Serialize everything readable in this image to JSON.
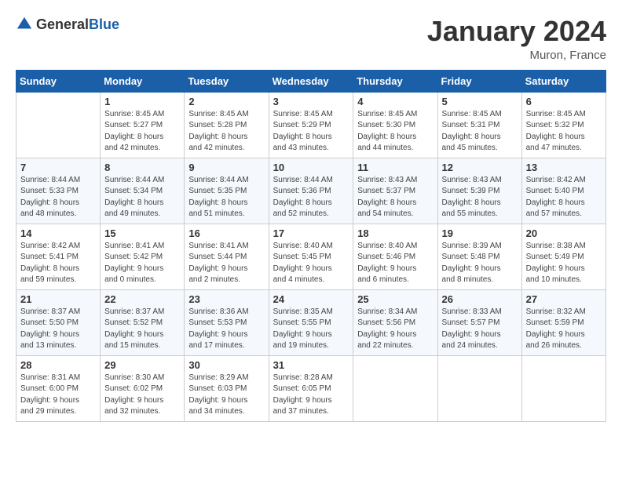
{
  "logo": {
    "general": "General",
    "blue": "Blue"
  },
  "header": {
    "month": "January 2024",
    "location": "Muron, France"
  },
  "weekdays": [
    "Sunday",
    "Monday",
    "Tuesday",
    "Wednesday",
    "Thursday",
    "Friday",
    "Saturday"
  ],
  "weeks": [
    [
      {
        "day": "",
        "info": ""
      },
      {
        "day": "1",
        "info": "Sunrise: 8:45 AM\nSunset: 5:27 PM\nDaylight: 8 hours\nand 42 minutes."
      },
      {
        "day": "2",
        "info": "Sunrise: 8:45 AM\nSunset: 5:28 PM\nDaylight: 8 hours\nand 42 minutes."
      },
      {
        "day": "3",
        "info": "Sunrise: 8:45 AM\nSunset: 5:29 PM\nDaylight: 8 hours\nand 43 minutes."
      },
      {
        "day": "4",
        "info": "Sunrise: 8:45 AM\nSunset: 5:30 PM\nDaylight: 8 hours\nand 44 minutes."
      },
      {
        "day": "5",
        "info": "Sunrise: 8:45 AM\nSunset: 5:31 PM\nDaylight: 8 hours\nand 45 minutes."
      },
      {
        "day": "6",
        "info": "Sunrise: 8:45 AM\nSunset: 5:32 PM\nDaylight: 8 hours\nand 47 minutes."
      }
    ],
    [
      {
        "day": "7",
        "info": "Sunrise: 8:44 AM\nSunset: 5:33 PM\nDaylight: 8 hours\nand 48 minutes."
      },
      {
        "day": "8",
        "info": "Sunrise: 8:44 AM\nSunset: 5:34 PM\nDaylight: 8 hours\nand 49 minutes."
      },
      {
        "day": "9",
        "info": "Sunrise: 8:44 AM\nSunset: 5:35 PM\nDaylight: 8 hours\nand 51 minutes."
      },
      {
        "day": "10",
        "info": "Sunrise: 8:44 AM\nSunset: 5:36 PM\nDaylight: 8 hours\nand 52 minutes."
      },
      {
        "day": "11",
        "info": "Sunrise: 8:43 AM\nSunset: 5:37 PM\nDaylight: 8 hours\nand 54 minutes."
      },
      {
        "day": "12",
        "info": "Sunrise: 8:43 AM\nSunset: 5:39 PM\nDaylight: 8 hours\nand 55 minutes."
      },
      {
        "day": "13",
        "info": "Sunrise: 8:42 AM\nSunset: 5:40 PM\nDaylight: 8 hours\nand 57 minutes."
      }
    ],
    [
      {
        "day": "14",
        "info": "Sunrise: 8:42 AM\nSunset: 5:41 PM\nDaylight: 8 hours\nand 59 minutes."
      },
      {
        "day": "15",
        "info": "Sunrise: 8:41 AM\nSunset: 5:42 PM\nDaylight: 9 hours\nand 0 minutes."
      },
      {
        "day": "16",
        "info": "Sunrise: 8:41 AM\nSunset: 5:44 PM\nDaylight: 9 hours\nand 2 minutes."
      },
      {
        "day": "17",
        "info": "Sunrise: 8:40 AM\nSunset: 5:45 PM\nDaylight: 9 hours\nand 4 minutes."
      },
      {
        "day": "18",
        "info": "Sunrise: 8:40 AM\nSunset: 5:46 PM\nDaylight: 9 hours\nand 6 minutes."
      },
      {
        "day": "19",
        "info": "Sunrise: 8:39 AM\nSunset: 5:48 PM\nDaylight: 9 hours\nand 8 minutes."
      },
      {
        "day": "20",
        "info": "Sunrise: 8:38 AM\nSunset: 5:49 PM\nDaylight: 9 hours\nand 10 minutes."
      }
    ],
    [
      {
        "day": "21",
        "info": "Sunrise: 8:37 AM\nSunset: 5:50 PM\nDaylight: 9 hours\nand 13 minutes."
      },
      {
        "day": "22",
        "info": "Sunrise: 8:37 AM\nSunset: 5:52 PM\nDaylight: 9 hours\nand 15 minutes."
      },
      {
        "day": "23",
        "info": "Sunrise: 8:36 AM\nSunset: 5:53 PM\nDaylight: 9 hours\nand 17 minutes."
      },
      {
        "day": "24",
        "info": "Sunrise: 8:35 AM\nSunset: 5:55 PM\nDaylight: 9 hours\nand 19 minutes."
      },
      {
        "day": "25",
        "info": "Sunrise: 8:34 AM\nSunset: 5:56 PM\nDaylight: 9 hours\nand 22 minutes."
      },
      {
        "day": "26",
        "info": "Sunrise: 8:33 AM\nSunset: 5:57 PM\nDaylight: 9 hours\nand 24 minutes."
      },
      {
        "day": "27",
        "info": "Sunrise: 8:32 AM\nSunset: 5:59 PM\nDaylight: 9 hours\nand 26 minutes."
      }
    ],
    [
      {
        "day": "28",
        "info": "Sunrise: 8:31 AM\nSunset: 6:00 PM\nDaylight: 9 hours\nand 29 minutes."
      },
      {
        "day": "29",
        "info": "Sunrise: 8:30 AM\nSunset: 6:02 PM\nDaylight: 9 hours\nand 32 minutes."
      },
      {
        "day": "30",
        "info": "Sunrise: 8:29 AM\nSunset: 6:03 PM\nDaylight: 9 hours\nand 34 minutes."
      },
      {
        "day": "31",
        "info": "Sunrise: 8:28 AM\nSunset: 6:05 PM\nDaylight: 9 hours\nand 37 minutes."
      },
      {
        "day": "",
        "info": ""
      },
      {
        "day": "",
        "info": ""
      },
      {
        "day": "",
        "info": ""
      }
    ]
  ]
}
